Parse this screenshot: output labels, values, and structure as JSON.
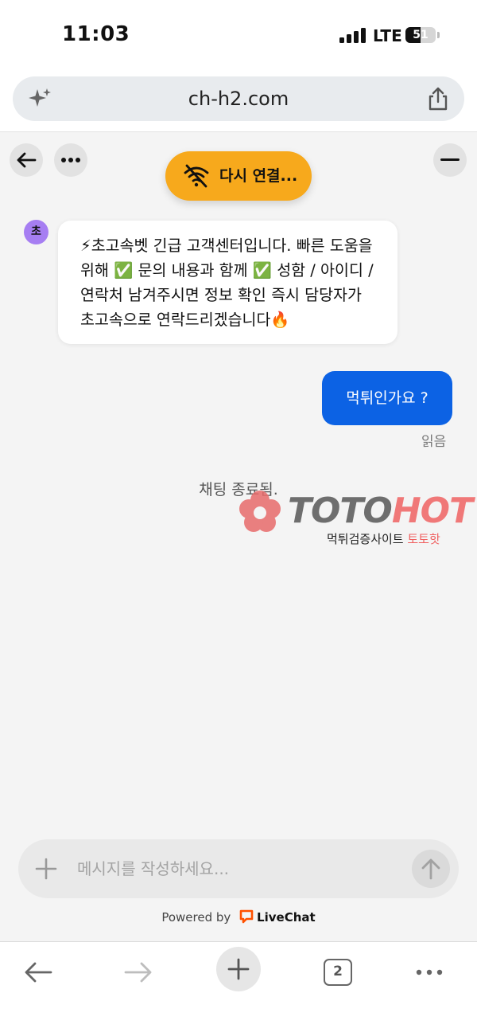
{
  "status_bar": {
    "time": "11:03",
    "network": "LTE",
    "battery": "51",
    "battery_level": 0.51
  },
  "browser": {
    "url": "ch-h2.com"
  },
  "chat": {
    "reconnect_label": "다시 연결...",
    "agent_avatar_initial": "초",
    "agent_message": "⚡초고속벳 긴급 고객센터입니다. 빠른 도움을 위해 ✅ 문의 내용과 함께 ✅ 성함 / 아이디 / 연락처 남겨주시면 정보 확인 즉시 담당자가 초고속으로 연락드리겠습니다🔥",
    "user_message": "먹튀인가요 ?",
    "read_status": "읽음",
    "chat_ended": "채팅 종료됨."
  },
  "watermark": {
    "brand_a": "TOTO",
    "brand_b": "HOT",
    "sub_a": "먹튀검증사이트 ",
    "sub_b": "토토핫"
  },
  "composer": {
    "placeholder": "메시지를 작성하세요..."
  },
  "footer": {
    "powered_by": "Powered by",
    "brand": "LiveChat"
  },
  "toolbar": {
    "tab_count": "2"
  },
  "colors": {
    "accent_blue": "#0c62e4",
    "reconnect_orange": "#f7a91c",
    "avatar_purple": "#a67ef2",
    "livechat_orange": "#ff5100"
  }
}
